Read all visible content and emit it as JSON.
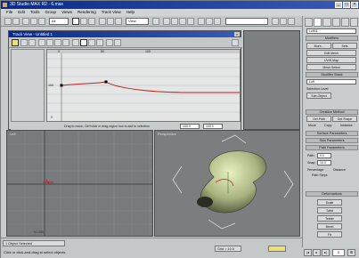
{
  "window": {
    "title": "3D Studio MAX R2 - 6.max"
  },
  "menu": [
    "File",
    "Edit",
    "Tools",
    "Group",
    "Views",
    "Rendering",
    "Track View",
    "Help"
  ],
  "toolbar": {
    "selection_filter": "All",
    "view_dropdown": "View",
    "named_sel": ""
  },
  "trackview": {
    "title": "Track View - Untitled 1",
    "status_hint": "Drag to move, Ctrl+click or drag region box to add to selection",
    "value_field_1": "100.0",
    "value_field_2": "100.0",
    "graph_ticks": [
      "0",
      "50",
      "100"
    ],
    "y_labels": [
      "100",
      "0"
    ]
  },
  "viewports": {
    "left_label": "Left",
    "left_counter": "0 / 100",
    "persp_label": "Perspective"
  },
  "cmdpanel": {
    "object_name": "Loft01",
    "modifier_title": "Modifiers",
    "more": "More...",
    "sets": "Sets",
    "edit_spline": "Edit Mesh",
    "uvw": "UVW Map",
    "mesh_select": "Mesh Select",
    "modifier_stack": "Modifier Stack",
    "stack_value": "Loft",
    "selection_level": "Selection Level",
    "sub_object": "Sub-Object",
    "creation_method": "Creation Method",
    "get_path": "Get Path",
    "get_shape": "Get Shape",
    "move": "Move",
    "copy": "Copy",
    "instance": "Instance",
    "surface_params": "Surface Parameters",
    "skin_params": "Skin Parameters",
    "path_params": "Path Parameters",
    "path_label": "Path:",
    "path_value": "0.0",
    "snap_label": "Snap:",
    "snap_value": "10.0",
    "percentage": "Percentage",
    "distance": "Distance",
    "path_steps": "Path Steps",
    "deformations": "Deformations",
    "scale": "Scale",
    "twist": "Twist",
    "teeter": "Teeter",
    "bevel": "Bevel",
    "fit": "Fit"
  },
  "statusbar": {
    "selection": "1 Object Selected",
    "prompt": "Click or click-and-drag to select objects",
    "grid": "Grid = 10.0",
    "frame": "0"
  }
}
